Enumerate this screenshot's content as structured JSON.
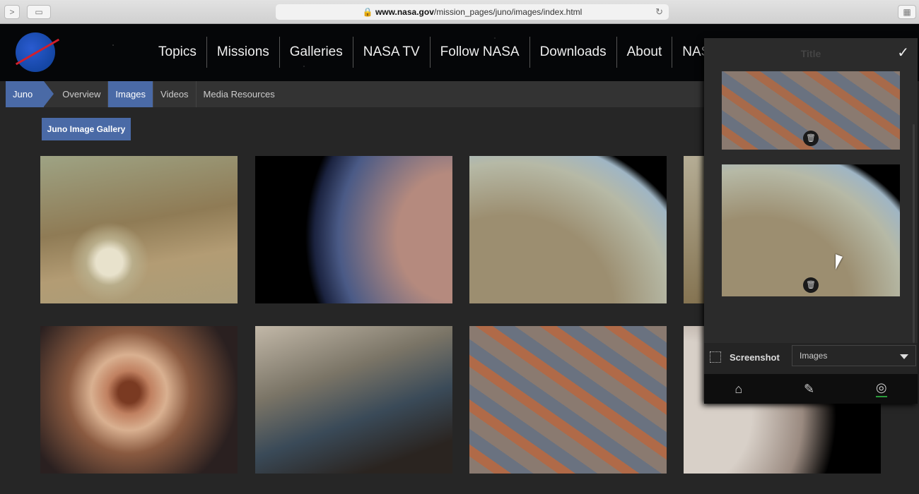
{
  "browser": {
    "url_domain": "www.nasa.gov",
    "url_path": "/mission_pages/juno/images/index.html",
    "forward_glyph": ">",
    "sidebar_glyph": "▭",
    "reload_glyph": "↻",
    "ext_glyph": "▦"
  },
  "header": {
    "logo_text": "NASA",
    "nav": [
      "Topics",
      "Missions",
      "Galleries",
      "NASA TV",
      "Follow NASA",
      "Downloads",
      "About",
      "NASA A"
    ]
  },
  "subnav": {
    "items": [
      "Juno",
      "Overview",
      "Images",
      "Videos",
      "Media Resources"
    ],
    "active": "Images"
  },
  "gallery": {
    "button": "Juno Image Gallery",
    "accent": "#4a6aa6"
  },
  "panel": {
    "title": "Title",
    "check": "✓",
    "trash": "🗑",
    "screenshot_label": "Screenshot",
    "select_value": "Images",
    "icons": [
      "home-icon",
      "edit-icon",
      "camera-icon"
    ],
    "home_glyph": "⌂",
    "edit_glyph": "✎",
    "camera_glyph": "◎"
  }
}
